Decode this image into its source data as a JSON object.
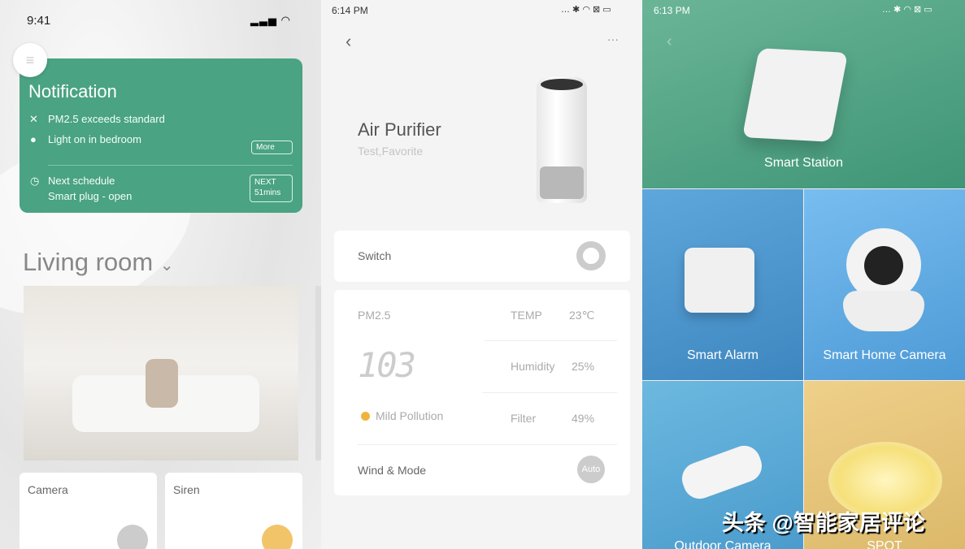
{
  "home": {
    "time": "9:41",
    "notification": {
      "title": "Notification",
      "items": [
        "PM2.5 exceeds standard",
        "Light on in bedroom"
      ],
      "more": "More",
      "schedule_title": "Next schedule",
      "schedule_item": "Smart plug - open",
      "next_label": "NEXT",
      "next_time": "51mins"
    },
    "room": "Living room",
    "devices": [
      "Camera",
      "Siren"
    ]
  },
  "purifier": {
    "time": "6:14 PM",
    "title": "Air Purifier",
    "subtitle": "Test,Favorite",
    "switch_label": "Switch",
    "pm_label": "PM2.5",
    "pm_value": "103",
    "pollution": "Mild Pollution",
    "temp_label": "TEMP",
    "temp_value": "23℃",
    "humidity_label": "Humidity",
    "humidity_value": "25%",
    "filter_label": "Filter",
    "filter_value": "49%",
    "wind_label": "Wind & Mode",
    "mode": "Auto"
  },
  "catalog": {
    "time": "6:13 PM",
    "tiles": [
      "Smart Station",
      "Smart Alarm",
      "Smart Home Camera",
      "Outdoor Camera",
      "SPOT"
    ],
    "watermark": "头条 @智能家居评论"
  },
  "colors": {
    "green": "#4aa383",
    "pollution_dot": "#f0b43c"
  }
}
